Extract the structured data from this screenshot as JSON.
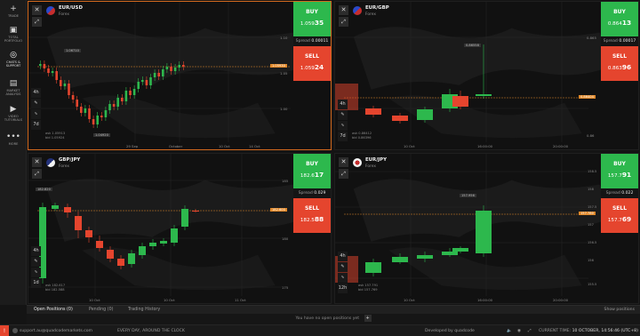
{
  "sidebar": {
    "items": [
      {
        "label": "TRADE",
        "icon": "plus-icon"
      },
      {
        "label": "TOTAL PORTFOLIO",
        "icon": "portfolio-icon"
      },
      {
        "label": "CHATS & SUPPORT",
        "icon": "chat-icon"
      },
      {
        "label": "MARKET ANALYSIS",
        "icon": "analysis-icon"
      },
      {
        "label": "VIDEO TUTORIALS",
        "icon": "play-icon"
      },
      {
        "label": "MORE",
        "icon": "more-icon"
      }
    ]
  },
  "panels": [
    {
      "pair": "EUR/USD",
      "category": "Forex",
      "buy": {
        "label": "BUY",
        "price_main": "1.059",
        "price_big": "35"
      },
      "spread_label": "Spread",
      "spread_value": "0.00011",
      "sell": {
        "label": "SELL",
        "price_main": "1.059",
        "price_big": "24"
      },
      "price_tag": "1.05930",
      "y_ticks": [
        "1.10",
        "1.05",
        "1.00"
      ],
      "x_ticks": [
        "29 Sep",
        "October",
        "10 Oct",
        "14 Oct"
      ],
      "high_label": "1.06710",
      "low_label": "1.04920",
      "ask_bid": [
        "ask 1.05913",
        "bid 1.05924"
      ],
      "timeframes": [
        "4h",
        "7d"
      ]
    },
    {
      "pair": "EUR/GBP",
      "category": "Forex",
      "buy": {
        "label": "BUY",
        "price_main": "0.864",
        "price_big": "13"
      },
      "spread_label": "Spread",
      "spread_value": "0.00017",
      "sell": {
        "label": "SELL",
        "price_main": "0.863",
        "price_big": "96"
      },
      "price_tag": "0.86404",
      "y_ticks": [
        "0.865",
        "0.86"
      ],
      "x_ticks": [
        "10 Oct",
        "16:00:00",
        "20:00:00"
      ],
      "high_label": "0.86558",
      "low_label": "",
      "ask_bid": [
        "ask 0.86412",
        "bid 0.86396"
      ],
      "timeframes": [
        "4h",
        "7d"
      ]
    },
    {
      "pair": "GBP/JPY",
      "category": "Forex",
      "buy": {
        "label": "BUY",
        "price_main": "182.6",
        "price_big": "17"
      },
      "spread_label": "Spread",
      "spread_value": "0.029",
      "sell": {
        "label": "SELL",
        "price_main": "182.5",
        "price_big": "88"
      },
      "price_tag": "182.600",
      "y_ticks": [
        "185",
        "180",
        "175"
      ],
      "x_ticks": [
        "10 Oct",
        "10 Oct",
        "11 Oct"
      ],
      "high_label": "182.820",
      "low_label": "",
      "ask_bid": [
        "ask 182.617",
        "bid 182.588"
      ],
      "timeframes": [
        "4h",
        "1d"
      ]
    },
    {
      "pair": "EUR/JPY",
      "category": "Forex",
      "buy": {
        "label": "BUY",
        "price_main": "157.7",
        "price_big": "91"
      },
      "spread_label": "Spread",
      "spread_value": "0.022",
      "sell": {
        "label": "SELL",
        "price_main": "157.7",
        "price_big": "69"
      },
      "price_tag": "157.780",
      "y_ticks": [
        "158.5",
        "158",
        "157.5",
        "157",
        "156.5",
        "156",
        "155.5"
      ],
      "x_ticks": [
        "10 Oct",
        "16:00:00",
        "20:00:00"
      ],
      "high_label": "157.956",
      "low_label": "",
      "ask_bid": [
        "ask 157.791",
        "bid 157.769"
      ],
      "timeframes": [
        "4h",
        "12h"
      ]
    }
  ],
  "bottom": {
    "tabs": [
      "Open Positions (0)",
      "Pending (0)",
      "Trading History"
    ],
    "show_positions": "Show positions",
    "empty_text": "You have no open positions yet"
  },
  "status": {
    "support": "support.au@quadcodemarkets.com",
    "hours": "EVERY DAY, AROUND THE CLOCK",
    "developed": "Developed by quadcode",
    "time_label": "CURRENT TIME:",
    "time_value": "10 OCTOBER, 14:56:46 (UTC+8)"
  },
  "colors": {
    "buy": "#2db84d",
    "sell": "#e5452e",
    "selected_border": "#d2691e",
    "price_line": "#e0882a"
  }
}
